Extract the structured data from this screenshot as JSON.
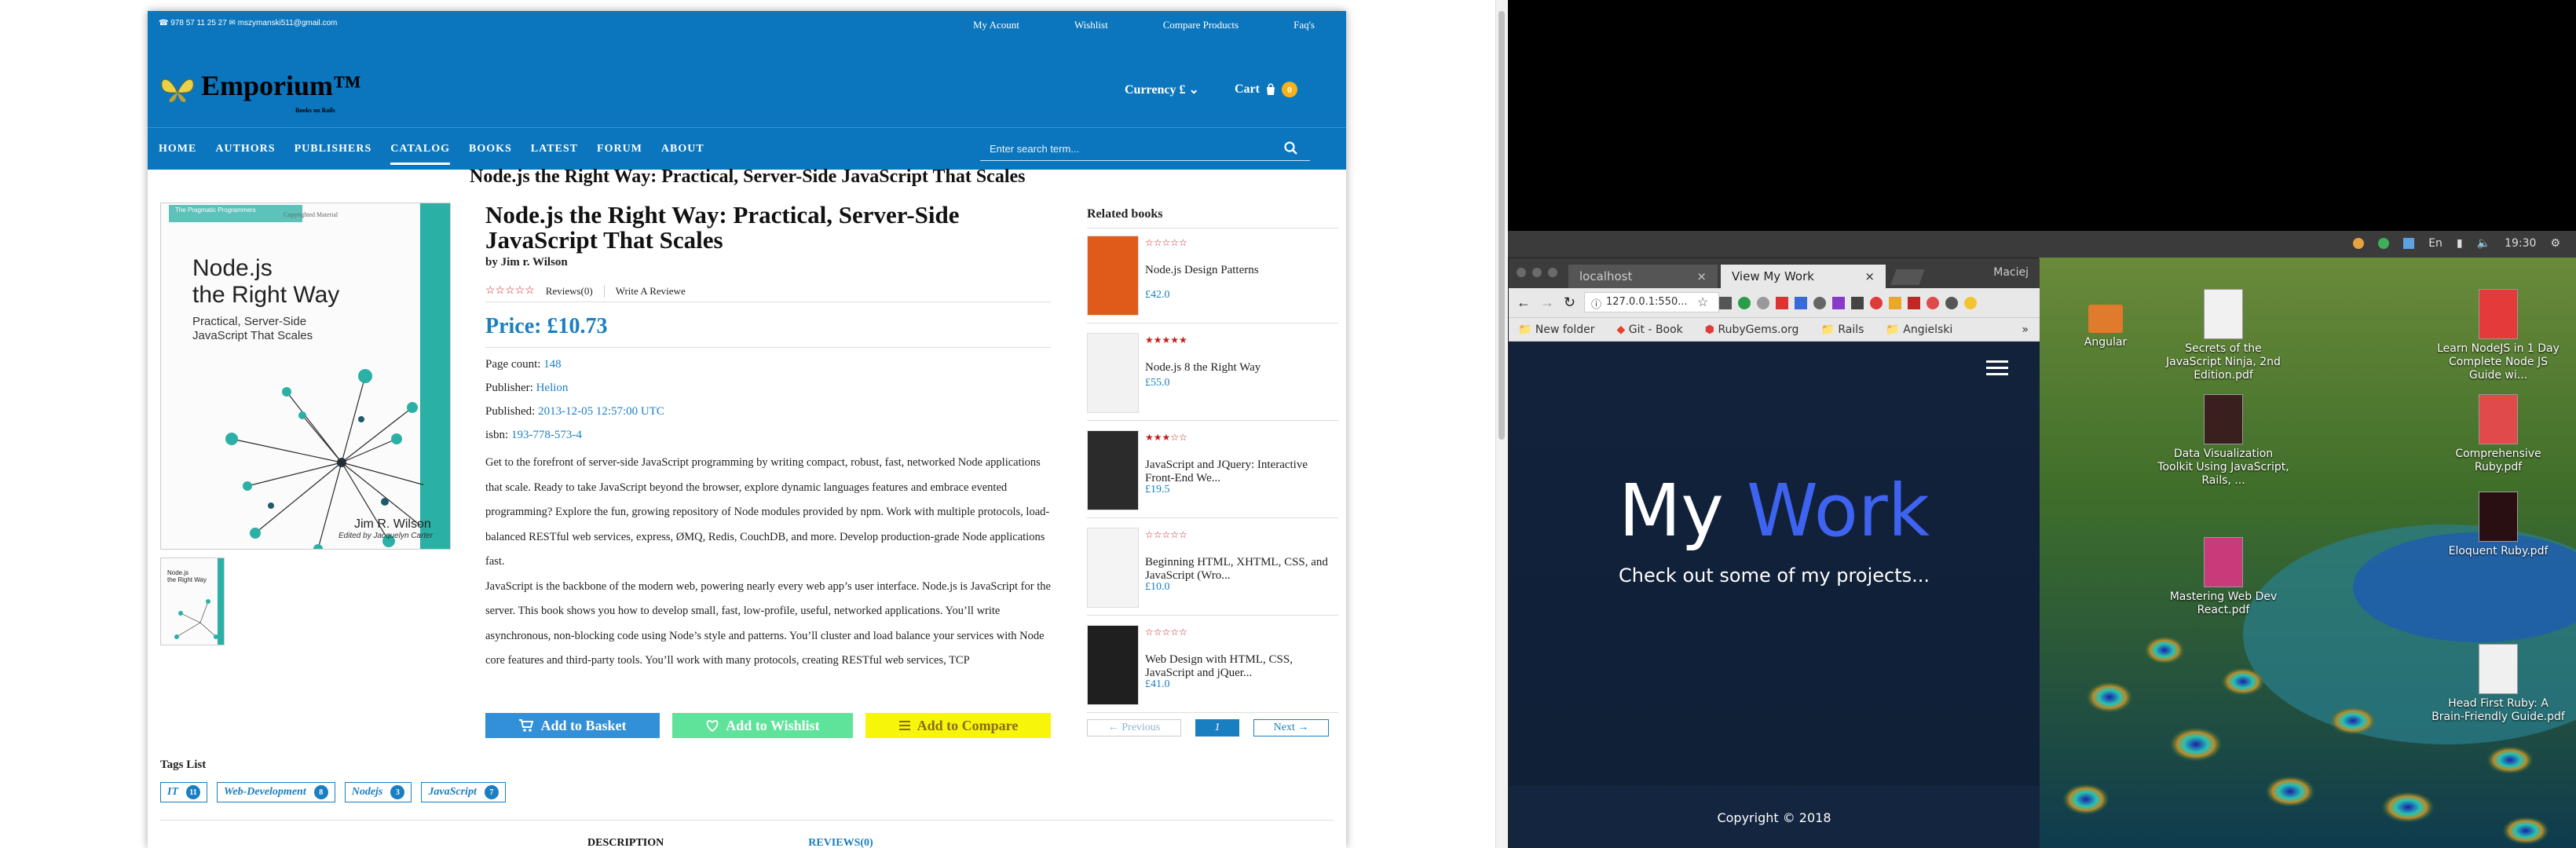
{
  "store": {
    "contact": "☎ 978 57 11 25 27  ✉ mszymanski511@gmail.com",
    "top_links": [
      "My Acount",
      "Wishlist",
      "Compare Products",
      "Faq's"
    ],
    "brand": "Emporium™",
    "brand_sub": "Books on Rails",
    "currency_label": "Currency £",
    "cart_label": "Cart",
    "cart_count": "0",
    "nav": [
      "HOME",
      "AUTHORS",
      "PUBLISHERS",
      "CATALOG",
      "BOOKS",
      "LATEST",
      "FORUM",
      "ABOUT"
    ],
    "nav_active": "CATALOG",
    "search_placeholder": "Enter search term...",
    "page_heading": "Node.js the Right Way: Practical, Server-Side JavaScript That Scales"
  },
  "book": {
    "title": "Node.js the Right Way: Practical, Server-Side JavaScript That Scales",
    "author": "by Jim r. Wilson",
    "rating": 0,
    "reviews": "Reviews(0)",
    "write_review": "Write A Reviewe",
    "price": "Price: £10.73",
    "page_count_label": "Page count:",
    "page_count": "148",
    "publisher_label": "Publisher:",
    "publisher": "Helion",
    "published_label": "Published:",
    "published": "2013-12-05 12:57:00 UTC",
    "isbn_label": "isbn:",
    "isbn": "193-778-573-4",
    "description_1": "Get to the forefront of server-side JavaScript programming by writing compact, robust, fast, networked Node applications that scale. Ready to take JavaScript beyond the browser, explore dynamic languages features and embrace evented programming? Explore the fun, growing repository of Node modules provided by npm. Work with multiple protocols, load-balanced RESTful web services, express, ØMQ, Redis, CouchDB, and more. Develop production-grade Node applications fast.",
    "description_2": "JavaScript is the backbone of the modern web, powering nearly every web app’s user interface. Node.js is JavaScript for the server. This book shows you how to develop small, fast, low-profile, useful, networked applications. You’ll write asynchronous, non-blocking code using Node’s style and patterns. You’ll cluster and load balance your services with Node core features and third-party tools. You’ll work with many protocols, creating RESTful web services, TCP",
    "cover_title_1": "Node.js",
    "cover_title_2": "the Right Way",
    "cover_subtitle": "Practical, Server-Side JavaScript That Scales",
    "cover_author": "Jim R. Wilson",
    "cover_editor": "Edited by Jacquelyn Carter",
    "cover_series": "The Pragmatic Programmers",
    "cover_corner": "Copyrighted Material"
  },
  "actions": {
    "basket": "Add to Basket",
    "wishlist": "Add to Wishlist",
    "compare": "Add to Compare"
  },
  "related": {
    "heading": "Related books",
    "items": [
      {
        "title": "Node.js Design Patterns",
        "price": "£42.0",
        "rating": 0,
        "color": "#e05a1a"
      },
      {
        "title": "Node.js 8 the Right Way",
        "price": "£55.0",
        "rating": 5,
        "color": "#f2f2f2"
      },
      {
        "title": "JavaScript and JQuery: Interactive Front-End We...",
        "price": "£19.5",
        "rating": 3,
        "color": "#2b2b2b"
      },
      {
        "title": "Beginning HTML, XHTML, CSS, and JavaScript (Wro...",
        "price": "£10.0",
        "rating": 0,
        "color": "#f4f4f4"
      },
      {
        "title": "Web Design with HTML, CSS, JavaScript and jQuer...",
        "price": "£41.0",
        "rating": 0,
        "color": "#1f1f1f"
      }
    ],
    "prev": "← Previous",
    "page": "1",
    "next": "Next →"
  },
  "tags": {
    "heading": "Tags List",
    "items": [
      {
        "name": "IT",
        "count": "11"
      },
      {
        "name": "Web-Development",
        "count": "8"
      },
      {
        "name": "Nodejs",
        "count": "3"
      },
      {
        "name": "JavaScript",
        "count": "7"
      }
    ]
  },
  "bottom_tabs": [
    "DESCRIPTION",
    "REVIEWS(0)"
  ],
  "desktop": {
    "clock": "19:30",
    "lang": "En",
    "user": "Maciej",
    "tabs": [
      "localhost",
      "View My Work"
    ],
    "url": "127.0.0.1:550...",
    "bookmarks": [
      "New folder",
      "Git - Book",
      "RubyGems.org",
      "Rails",
      "Angielski"
    ],
    "site_title_1": "My",
    "site_title_2": "Work",
    "site_subtitle": "Check out some of my projects...",
    "site_footer": "Copyright © 2018",
    "accent": "#3e63f0",
    "icons": [
      {
        "label": "Angular",
        "kind": "folder"
      },
      {
        "label": "Secrets of the JavaScript Ninja, 2nd Edition.pdf",
        "kind": "pdf"
      },
      {
        "label": "Learn NodeJS in 1 Day Complete Node JS Guide wi...",
        "kind": "pdf"
      },
      {
        "label": "Data Visualization Toolkit Using JavaScript, Rails, ...",
        "kind": "pdf"
      },
      {
        "label": "Comprehensive Ruby.pdf",
        "kind": "pdf"
      },
      {
        "label": "Eloquent Ruby.pdf",
        "kind": "pdf"
      },
      {
        "label": "Mastering Web Dev React.pdf",
        "kind": "pdf"
      },
      {
        "label": "Head First Ruby: A Brain-Friendly Guide.pdf",
        "kind": "pdf"
      }
    ]
  }
}
